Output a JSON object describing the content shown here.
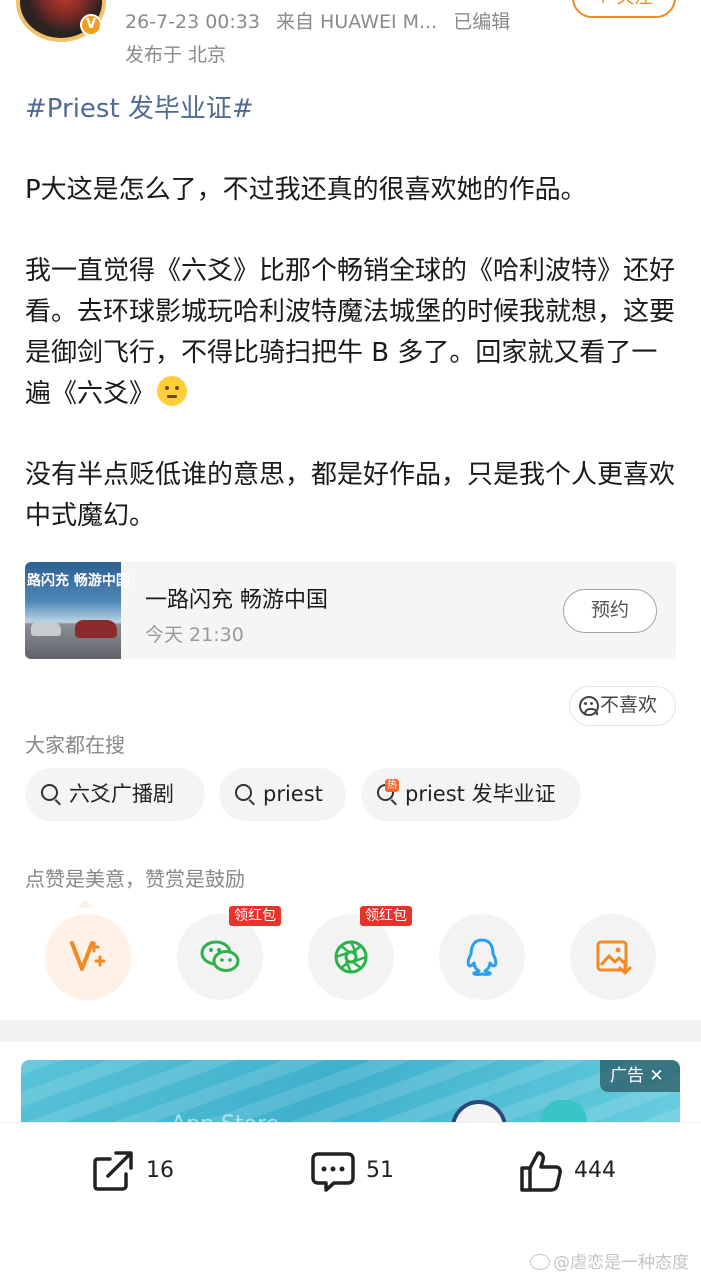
{
  "post_meta": {
    "date": "26-7-23 00:33",
    "source": "来自 HUAWEI M...",
    "edited": "已编辑",
    "location": "发布于 北京",
    "follow_label": "+ 关注"
  },
  "post": {
    "hashtag": "#Priest 发毕业证#",
    "paragraph_1": "P大这是怎么了，不过我还真的很喜欢她的作品。",
    "paragraph_2": "我一直觉得《六爻》比那个畅销全球的《哈利波特》还好看。去环球影城玩哈利波特魔法城堡的时候我就想，这要是御剑飞行，不得比骑扫把牛 B 多了。回家就又看了一遍《六爻》",
    "paragraph_3": "没有半点贬低谁的意思，都是好作品，只是我个人更喜欢中式魔幻。"
  },
  "live_card": {
    "thumb_text": "路闪充 畅游中国",
    "title": "一路闪充 畅游中国",
    "time": "今天 21:30",
    "button_label": "预约"
  },
  "dislike_label": "不喜欢",
  "search": {
    "title": "大家都在搜",
    "chips": [
      {
        "label": "六爻广播剧",
        "hot": false
      },
      {
        "label": "priest",
        "hot": false
      },
      {
        "label": "priest 发毕业证",
        "hot": true
      }
    ],
    "hot_tag": "热"
  },
  "reward": {
    "title": "点赞是美意，赞赏是鼓励",
    "red_packet_label": "领红包",
    "actions": [
      {
        "icon": "v-plus-icon",
        "color": "#f08a24"
      },
      {
        "icon": "wechat-icon",
        "color": "#2bb34a"
      },
      {
        "icon": "moments-icon",
        "color": "#2bb34a"
      },
      {
        "icon": "qq-icon",
        "color": "#2a9ff2"
      },
      {
        "icon": "save-image-icon",
        "color": "#f08a24"
      }
    ]
  },
  "ad": {
    "tag": "广告 ✕",
    "store_text": " App Store"
  },
  "toolbar": {
    "share_count": "16",
    "comment_count": "51",
    "like_count": "444"
  },
  "watermark": "@虐恋是一种态度"
}
